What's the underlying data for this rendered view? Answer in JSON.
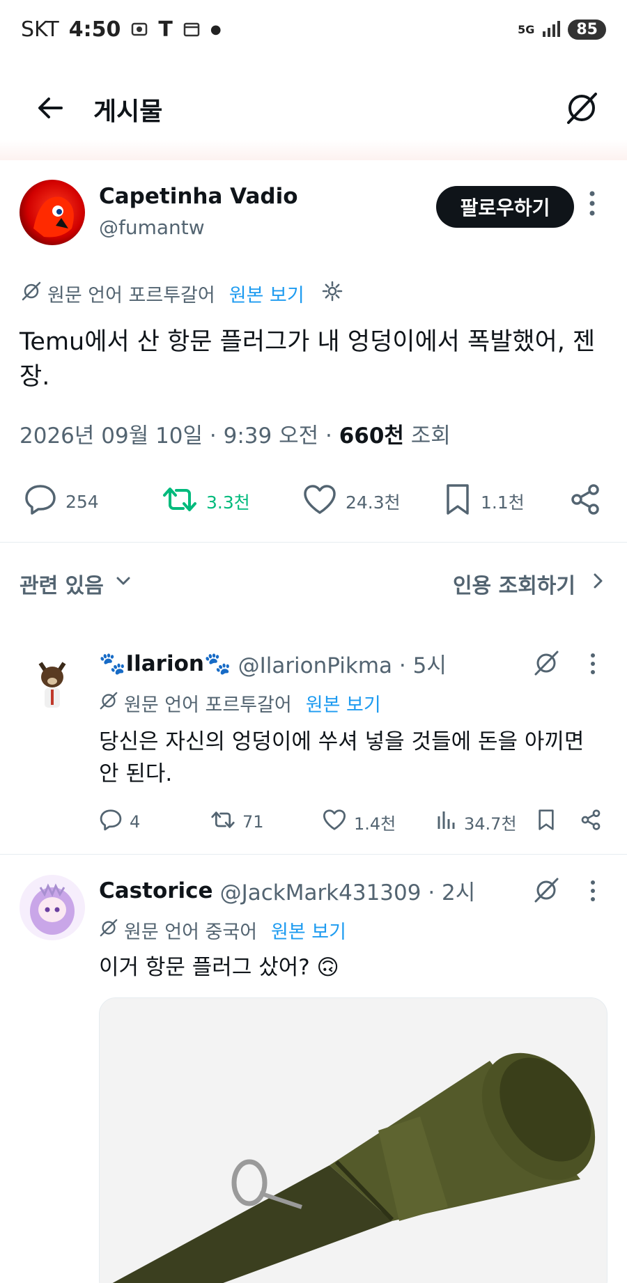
{
  "status_bar": {
    "carrier": "SKT",
    "time": "4:50",
    "network": "5G",
    "battery": "85"
  },
  "header": {
    "title": "게시물"
  },
  "post": {
    "author_name": "Capetinha Vadio",
    "author_handle": "@fumantw",
    "follow_label": "팔로우하기",
    "translate_label": "원문 언어 포르투갈어",
    "translate_link": "원본 보기",
    "text": "Temu에서 산 항문 플러그가 내 엉덩이에서 폭발했어, 젠장.",
    "date": "2026년 09월 10일 · 9:39 오전 · ",
    "views_count": "660천",
    "views_label": " 조회",
    "replies": "254",
    "reposts": "3.3천",
    "likes": "24.3천",
    "bookmarks": "1.1천"
  },
  "related": {
    "label": "관련 있음",
    "quotes_label": "인용 조회하기"
  },
  "replies": [
    {
      "name": "🐾Ilarion🐾",
      "handle": "@IlarionPikma · 5시",
      "translate_label": "원문 언어 포르투갈어",
      "translate_link": "원본 보기",
      "text": "당신은 자신의 엉덩이에 쑤셔 넣을 것들에 돈을 아끼면 안 된다.",
      "replies": "4",
      "reposts": "71",
      "likes": "1.4천",
      "views": "34.7천"
    },
    {
      "name": "Castorice",
      "handle": "@JackMark431309 · 2시",
      "translate_label": "원문 언어 중국어",
      "translate_link": "원본 보기",
      "text": "이거 항문 플러그 샀어? 🙃"
    }
  ],
  "colors": {
    "accent": "#1d9bf0",
    "repost_green": "#00ba7c",
    "text": "#0f1419",
    "muted": "#536471"
  }
}
